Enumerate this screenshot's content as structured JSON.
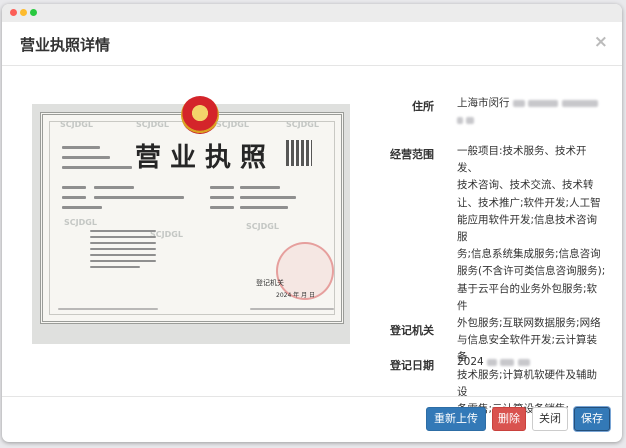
{
  "dialog": {
    "title": "营业执照详情",
    "close_glyph": "×"
  },
  "license_image": {
    "title": "营业执照",
    "watermark": "SCJDGL",
    "registration_authority_label": "登记机关",
    "year_text": "2024 年 月 日"
  },
  "details": {
    "address_label": "住所",
    "address_value": "上海市闵行",
    "scope_label": "经营范围",
    "scope_lines": [
      "一般项目:技术服务、技术开发、",
      "技术咨询、技术交流、技术转",
      "让、技术推广;软件开发;人工智",
      "能应用软件开发;信息技术咨询服",
      "务;信息系统集成服务;信息咨询",
      "服务(不含许可类信息咨询服务);",
      "基于云平台的业务外包服务;软件",
      "外包服务;互联网数据服务;网络",
      "与信息安全软件开发;云计算装备",
      "技术服务;计算机软硬件及辅助设",
      "备零售;云计算设备销售;"
    ],
    "authority_label": "登记机关",
    "date_label": "登记日期",
    "date_value": "2024"
  },
  "footer": {
    "reupload_label": "重新上传",
    "delete_label": "删除",
    "close_label": "关闭",
    "save_label": "保存"
  },
  "colors": {
    "primary": "#3379b7",
    "danger": "#d9534f"
  }
}
